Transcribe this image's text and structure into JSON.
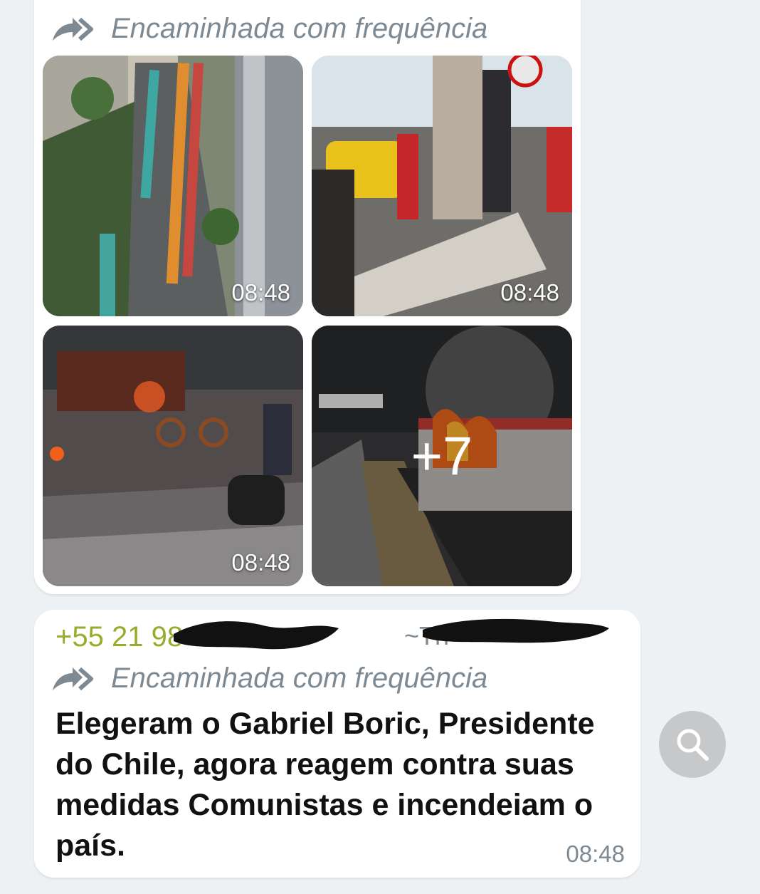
{
  "media_message": {
    "forwarded_label": "Encaminhada com frequência",
    "tiles": [
      {
        "time": "08:48"
      },
      {
        "time": "08:48"
      },
      {
        "time": "08:48"
      },
      {
        "more_count": "+7"
      }
    ]
  },
  "text_message": {
    "sender_number": "+55 21 98",
    "sender_alias": "~Th",
    "forwarded_label": "Encaminhada com frequência",
    "body": "Elegeram o Gabriel Boric, Presidente do Chile, agora reagem contra suas medidas Comunistas e incendeiam o país.",
    "time": "08:48"
  },
  "icons": {
    "forward": "forward-double-arrow-icon",
    "search": "search-icon"
  },
  "colors": {
    "chat_background": "#eef1f3",
    "bubble": "#ffffff",
    "meta_text": "#7d8a94",
    "sender_name": "#9aab2b",
    "search_button": "#c6c8ca"
  }
}
